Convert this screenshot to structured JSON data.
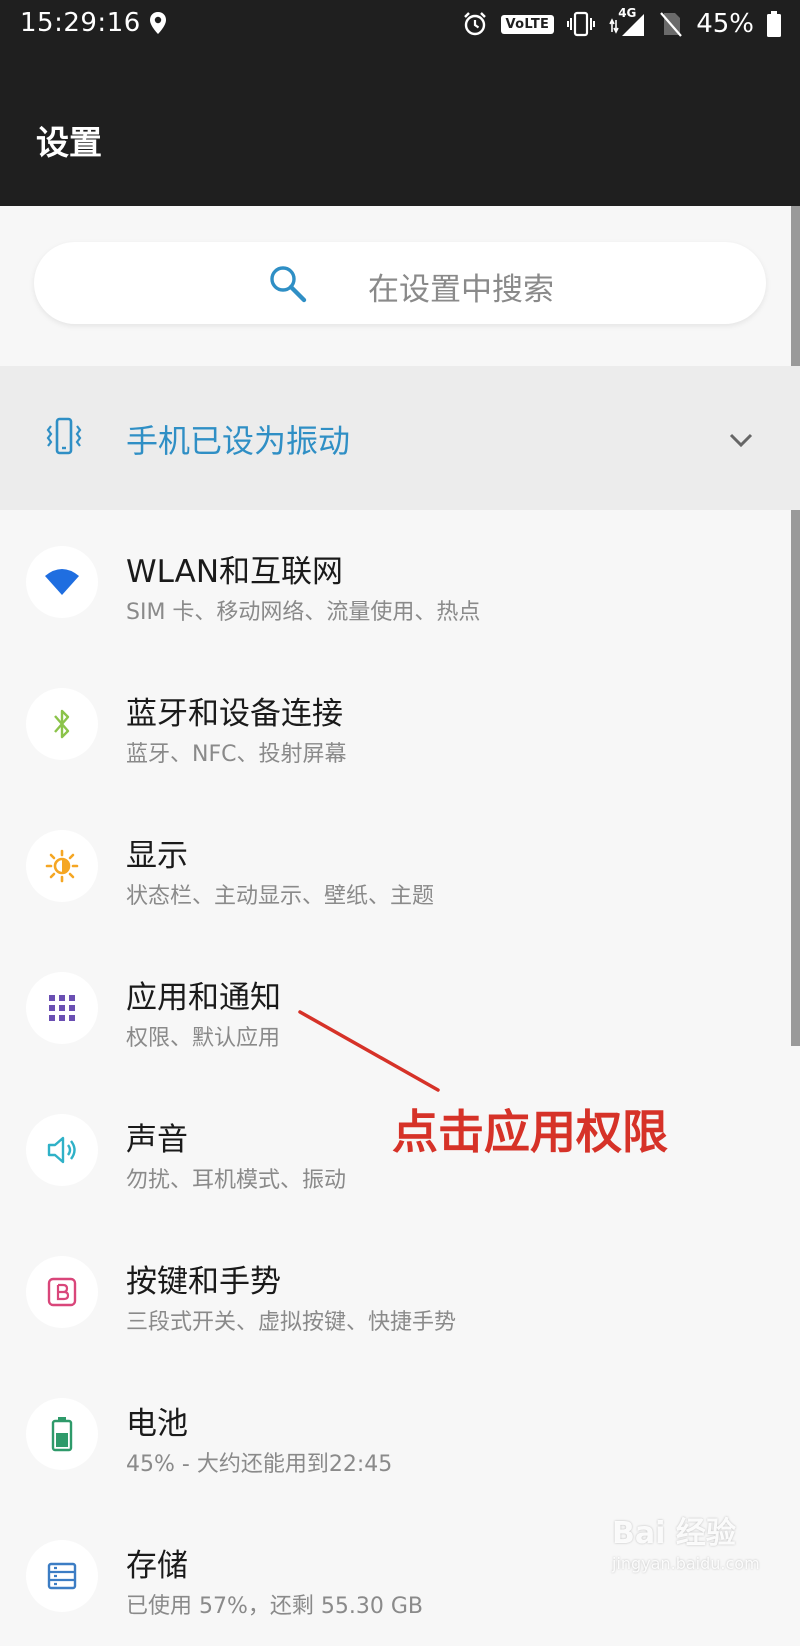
{
  "status_bar": {
    "time": "15:29:16",
    "volte": "VoLTE",
    "network": "4G",
    "battery": "45%",
    "icons": [
      "location-icon",
      "alarm-icon",
      "volte-icon",
      "vibrate-icon",
      "signal-icon",
      "no-sim-icon",
      "battery-icon"
    ]
  },
  "app_bar": {
    "title": "设置"
  },
  "search": {
    "placeholder": "在设置中搜索"
  },
  "vibrate_banner": {
    "text": "手机已设为振动"
  },
  "settings": [
    {
      "title": "WLAN和互联网",
      "subtitle": "SIM 卡、移动网络、流量使用、热点",
      "icon": "wifi-icon",
      "icon_color": "#1f6ee0"
    },
    {
      "title": "蓝牙和设备连接",
      "subtitle": "蓝牙、NFC、投射屏幕",
      "icon": "bluetooth-icon",
      "icon_color": "#8bc34a"
    },
    {
      "title": "显示",
      "subtitle": "状态栏、主动显示、壁纸、主题",
      "icon": "brightness-icon",
      "icon_color": "#f5a623"
    },
    {
      "title": "应用和通知",
      "subtitle": "权限、默认应用",
      "icon": "apps-grid-icon",
      "icon_color": "#6a4fb3"
    },
    {
      "title": "声音",
      "subtitle": "勿扰、耳机模式、振动",
      "icon": "sound-icon",
      "icon_color": "#2fb1c7"
    },
    {
      "title": "按键和手势",
      "subtitle": "三段式开关、虚拟按键、快捷手势",
      "icon": "buttons-gestures-icon",
      "icon_color": "#d9467a"
    },
    {
      "title": "电池",
      "subtitle": "45% - 大约还能用到22:45",
      "icon": "battery-icon",
      "icon_color": "#2e9a6a"
    },
    {
      "title": "存储",
      "subtitle": "已使用 57%，还剩 55.30 GB",
      "icon": "storage-icon",
      "icon_color": "#3c7dc4"
    }
  ],
  "annotation": {
    "text": "点击应用权限",
    "color": "#d63228"
  },
  "watermark": {
    "text": "Bai 经验",
    "sub": "jingyan.baidu.com"
  }
}
